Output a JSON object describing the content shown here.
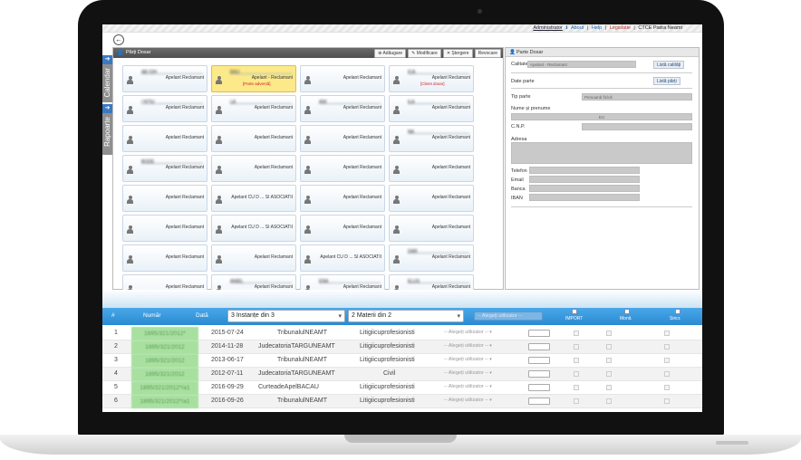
{
  "toplinks": {
    "user": "Administrator",
    "about": "About",
    "help": "Help",
    "leg": "Legislatie",
    "org": "CTCE Piatra Neamt",
    "sep": "|"
  },
  "sidebar": {
    "calendar": "Calendar",
    "rapoarte": "Rapoarte",
    "arrow": "➜"
  },
  "leftpanel": {
    "title": "Părți Dosar",
    "btn_add": "Adăugare",
    "btn_mod": "Modificare",
    "btn_del": "Ștergere",
    "btn_rev": "Revocare",
    "cards": [
      {
        "name": "AB                        /OH",
        "role": "Apelant Reclamant",
        "note": "",
        "sel": false
      },
      {
        "name": "                          EKU",
        "role": "Apelant - Reclamant",
        "note": "[Parte adversă]",
        "sel": true
      },
      {
        "name": "",
        "role": "Apelant Reclamant",
        "note": "",
        "sel": false
      },
      {
        "name": "                       ICA",
        "role": "Apelant Reclamant",
        "note": "[Client dosar]",
        "sel": false
      },
      {
        "name": "/                   NTIU",
        "role": "Apelant Reclamant",
        "note": "",
        "sel": false
      },
      {
        "name": "                        LA",
        "role": "Apelant Reclamant",
        "note": "",
        "sel": false
      },
      {
        "name": "ANI",
        "role": "Apelant Reclamant",
        "note": "",
        "sel": false
      },
      {
        "name": "                      ILA",
        "role": "Apelant Reclamant",
        "note": "",
        "sel": false
      },
      {
        "name": "",
        "role": "Apelant Reclamant",
        "note": "",
        "sel": false
      },
      {
        "name": "",
        "role": "Apelant Reclamant",
        "note": "",
        "sel": false
      },
      {
        "name": "",
        "role": "Apelant Reclamant",
        "note": "",
        "sel": false
      },
      {
        "name": "                      NA",
        "role": "Apelant Reclamant",
        "note": "",
        "sel": false
      },
      {
        "name": "BODE",
        "role": "Apelant Reclamant",
        "note": "",
        "sel": false
      },
      {
        "name": "",
        "role": "Apelant Reclamant",
        "note": "",
        "sel": false
      },
      {
        "name": "",
        "role": "Apelant Reclamant",
        "note": "",
        "sel": false
      },
      {
        "name": "",
        "role": "Apelant Reclamant",
        "note": "",
        "sel": false
      },
      {
        "name": "",
        "role": "Apelant Reclamant",
        "note": "",
        "sel": false
      },
      {
        "name": "",
        "role": "Apelant CU D ... SI ASOCIATII",
        "note": "",
        "sel": false
      },
      {
        "name": "",
        "role": "Apelant Reclamant",
        "note": "",
        "sel": false
      },
      {
        "name": "",
        "role": "Apelant Reclamant",
        "note": "",
        "sel": false
      },
      {
        "name": "",
        "role": "Apelant Reclamant",
        "note": "",
        "sel": false
      },
      {
        "name": "",
        "role": "Apelant CU D ... SI ASOCIATII",
        "note": "",
        "sel": false
      },
      {
        "name": "",
        "role": "Apelant Reclamant",
        "note": "",
        "sel": false
      },
      {
        "name": "",
        "role": "Apelant Reclamant",
        "note": "",
        "sel": false
      },
      {
        "name": "",
        "role": "Apelant Reclamant",
        "note": "",
        "sel": false
      },
      {
        "name": "",
        "role": "Apelant Reclamant",
        "note": "",
        "sel": false
      },
      {
        "name": "",
        "role": "Apelant CU D ... SI ASOCIATII",
        "note": "",
        "sel": false
      },
      {
        "name": "DAR",
        "role": "Apelant Reclamant",
        "note": "",
        "sel": false
      },
      {
        "name": "",
        "role": "Apelant Reclamant",
        "note": "",
        "sel": false
      },
      {
        "name": "                  ANIEL",
        "role": "Apelant Reclamant",
        "note": "",
        "sel": false
      },
      {
        "name": "                ENA",
        "role": "Apelant Reclamant",
        "note": "",
        "sel": false
      },
      {
        "name": "                 ELUS",
        "role": "Apelant Reclamant",
        "note": "",
        "sel": false
      }
    ]
  },
  "rightpanel": {
    "title": "Parte Dosar",
    "calitate_label": "Calitate",
    "calitate_value": "Apelant - Reclamant",
    "btn_calitati": "Listă calități",
    "date_parte": "Date parte",
    "btn_parti": "Listă părți",
    "tip_label": "Tip parte",
    "tip_value": "Persoană fizică",
    "nume_label": "Nume și prenume",
    "nume_value": "EU",
    "cnp_label": "C.N.P.",
    "adresa_label": "Adresa",
    "telefon": "Telefon",
    "email": "Email",
    "banca": "Banca",
    "iban": "IBAN"
  },
  "table": {
    "h_idx": "#",
    "h_num": "Număr",
    "h_data": "Dată",
    "sel_instante": "3 Instanțe din 3",
    "sel_materii": "2 Materii din 2",
    "sel_user": "-- Alegeți utilizator --",
    "h_import": "IMPORT",
    "h_monit": "Monit.",
    "h_sincr": "Sincr.",
    "rows": [
      {
        "i": "1",
        "num": "1895/321/2012*",
        "date": "2015-07-24",
        "inst": "TribunalulNEAMT",
        "mat": "Litigiicuprofesionisti",
        "user": "-- Alegeți utilizator --"
      },
      {
        "i": "2",
        "num": "1895/321/2012",
        "date": "2014-11-28",
        "inst": "JudecatoriaTARGUNEAMT",
        "mat": "Litigiicuprofesionisti",
        "user": "-- Alegeți utilizator --"
      },
      {
        "i": "3",
        "num": "1895/321/2012",
        "date": "2013-06-17",
        "inst": "TribunalulNEAMT",
        "mat": "Litigiicuprofesionisti",
        "user": "-- Alegeți utilizator --"
      },
      {
        "i": "4",
        "num": "1895/321/2012",
        "date": "2012-07-11",
        "inst": "JudecatoriaTARGUNEAMT",
        "mat": "Civil",
        "user": "-- Alegeți utilizator --"
      },
      {
        "i": "5",
        "num": "1895/321/2012*/a1",
        "date": "2016-09-29",
        "inst": "CurteadeApelBACAU",
        "mat": "Litigiicuprofesionisti",
        "user": "-- Alegeți utilizator --"
      },
      {
        "i": "6",
        "num": "1895/321/2012*/a1",
        "date": "2016-09-26",
        "inst": "TribunalulNEAMT",
        "mat": "Litigiicuprofesionisti",
        "user": "-- Alegeți utilizator --"
      }
    ]
  }
}
